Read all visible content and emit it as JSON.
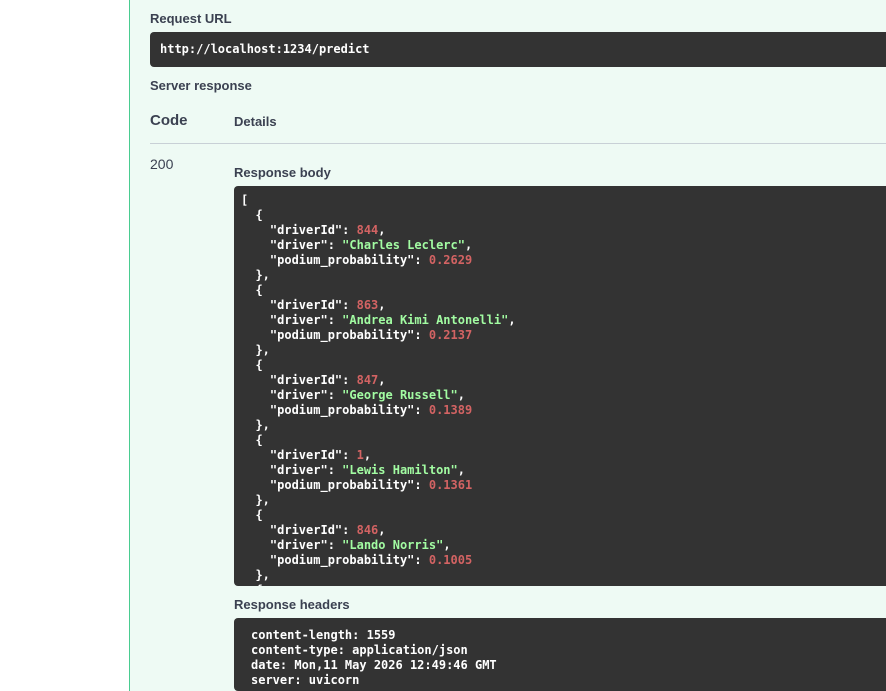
{
  "request_url": {
    "label": "Request URL",
    "value": "http://localhost:1234/predict"
  },
  "server_response": {
    "label": "Server response",
    "col_code": "Code",
    "col_details": "Details",
    "code": "200",
    "body_label": "Response body",
    "headers_label": "Response headers",
    "body": [
      {
        "driverId": "844",
        "driver": "\"Charles Leclerc\"",
        "podium_probability": "0.2629"
      },
      {
        "driverId": "863",
        "driver": "\"Andrea Kimi Antonelli\"",
        "podium_probability": "0.2137"
      },
      {
        "driverId": "847",
        "driver": "\"George Russell\"",
        "podium_probability": "0.1389"
      },
      {
        "driverId": "1",
        "driver": "\"Lewis Hamilton\"",
        "podium_probability": "0.1361"
      },
      {
        "driverId": "846",
        "driver": "\"Lando Norris\"",
        "podium_probability": "0.1005"
      }
    ],
    "headers": [
      "content-length: 1559",
      "content-type: application/json",
      "date: Mon,11 May 2026 12:49:46 GMT",
      "server: uvicorn"
    ]
  },
  "keys": {
    "driverId": "\"driverId\"",
    "driver": "\"driver\"",
    "podium_probability": "\"podium_probability\""
  },
  "colors": {
    "panel_bg": "#eefaf4",
    "panel_border": "#49cc90",
    "code_bg": "#333333",
    "json_string": "#a2fca2",
    "json_number": "#d36363"
  }
}
